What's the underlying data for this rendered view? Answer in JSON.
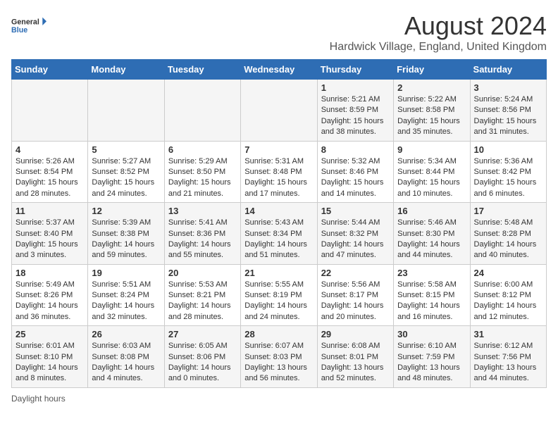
{
  "header": {
    "logo_general": "General",
    "logo_blue": "Blue",
    "main_title": "August 2024",
    "subtitle": "Hardwick Village, England, United Kingdom"
  },
  "days_of_week": [
    "Sunday",
    "Monday",
    "Tuesday",
    "Wednesday",
    "Thursday",
    "Friday",
    "Saturday"
  ],
  "weeks": [
    [
      {
        "day": "",
        "info": ""
      },
      {
        "day": "",
        "info": ""
      },
      {
        "day": "",
        "info": ""
      },
      {
        "day": "",
        "info": ""
      },
      {
        "day": "1",
        "info": "Sunrise: 5:21 AM\nSunset: 8:59 PM\nDaylight: 15 hours\nand 38 minutes."
      },
      {
        "day": "2",
        "info": "Sunrise: 5:22 AM\nSunset: 8:58 PM\nDaylight: 15 hours\nand 35 minutes."
      },
      {
        "day": "3",
        "info": "Sunrise: 5:24 AM\nSunset: 8:56 PM\nDaylight: 15 hours\nand 31 minutes."
      }
    ],
    [
      {
        "day": "4",
        "info": "Sunrise: 5:26 AM\nSunset: 8:54 PM\nDaylight: 15 hours\nand 28 minutes."
      },
      {
        "day": "5",
        "info": "Sunrise: 5:27 AM\nSunset: 8:52 PM\nDaylight: 15 hours\nand 24 minutes."
      },
      {
        "day": "6",
        "info": "Sunrise: 5:29 AM\nSunset: 8:50 PM\nDaylight: 15 hours\nand 21 minutes."
      },
      {
        "day": "7",
        "info": "Sunrise: 5:31 AM\nSunset: 8:48 PM\nDaylight: 15 hours\nand 17 minutes."
      },
      {
        "day": "8",
        "info": "Sunrise: 5:32 AM\nSunset: 8:46 PM\nDaylight: 15 hours\nand 14 minutes."
      },
      {
        "day": "9",
        "info": "Sunrise: 5:34 AM\nSunset: 8:44 PM\nDaylight: 15 hours\nand 10 minutes."
      },
      {
        "day": "10",
        "info": "Sunrise: 5:36 AM\nSunset: 8:42 PM\nDaylight: 15 hours\nand 6 minutes."
      }
    ],
    [
      {
        "day": "11",
        "info": "Sunrise: 5:37 AM\nSunset: 8:40 PM\nDaylight: 15 hours\nand 3 minutes."
      },
      {
        "day": "12",
        "info": "Sunrise: 5:39 AM\nSunset: 8:38 PM\nDaylight: 14 hours\nand 59 minutes."
      },
      {
        "day": "13",
        "info": "Sunrise: 5:41 AM\nSunset: 8:36 PM\nDaylight: 14 hours\nand 55 minutes."
      },
      {
        "day": "14",
        "info": "Sunrise: 5:43 AM\nSunset: 8:34 PM\nDaylight: 14 hours\nand 51 minutes."
      },
      {
        "day": "15",
        "info": "Sunrise: 5:44 AM\nSunset: 8:32 PM\nDaylight: 14 hours\nand 47 minutes."
      },
      {
        "day": "16",
        "info": "Sunrise: 5:46 AM\nSunset: 8:30 PM\nDaylight: 14 hours\nand 44 minutes."
      },
      {
        "day": "17",
        "info": "Sunrise: 5:48 AM\nSunset: 8:28 PM\nDaylight: 14 hours\nand 40 minutes."
      }
    ],
    [
      {
        "day": "18",
        "info": "Sunrise: 5:49 AM\nSunset: 8:26 PM\nDaylight: 14 hours\nand 36 minutes."
      },
      {
        "day": "19",
        "info": "Sunrise: 5:51 AM\nSunset: 8:24 PM\nDaylight: 14 hours\nand 32 minutes."
      },
      {
        "day": "20",
        "info": "Sunrise: 5:53 AM\nSunset: 8:21 PM\nDaylight: 14 hours\nand 28 minutes."
      },
      {
        "day": "21",
        "info": "Sunrise: 5:55 AM\nSunset: 8:19 PM\nDaylight: 14 hours\nand 24 minutes."
      },
      {
        "day": "22",
        "info": "Sunrise: 5:56 AM\nSunset: 8:17 PM\nDaylight: 14 hours\nand 20 minutes."
      },
      {
        "day": "23",
        "info": "Sunrise: 5:58 AM\nSunset: 8:15 PM\nDaylight: 14 hours\nand 16 minutes."
      },
      {
        "day": "24",
        "info": "Sunrise: 6:00 AM\nSunset: 8:12 PM\nDaylight: 14 hours\nand 12 minutes."
      }
    ],
    [
      {
        "day": "25",
        "info": "Sunrise: 6:01 AM\nSunset: 8:10 PM\nDaylight: 14 hours\nand 8 minutes."
      },
      {
        "day": "26",
        "info": "Sunrise: 6:03 AM\nSunset: 8:08 PM\nDaylight: 14 hours\nand 4 minutes."
      },
      {
        "day": "27",
        "info": "Sunrise: 6:05 AM\nSunset: 8:06 PM\nDaylight: 14 hours\nand 0 minutes."
      },
      {
        "day": "28",
        "info": "Sunrise: 6:07 AM\nSunset: 8:03 PM\nDaylight: 13 hours\nand 56 minutes."
      },
      {
        "day": "29",
        "info": "Sunrise: 6:08 AM\nSunset: 8:01 PM\nDaylight: 13 hours\nand 52 minutes."
      },
      {
        "day": "30",
        "info": "Sunrise: 6:10 AM\nSunset: 7:59 PM\nDaylight: 13 hours\nand 48 minutes."
      },
      {
        "day": "31",
        "info": "Sunrise: 6:12 AM\nSunset: 7:56 PM\nDaylight: 13 hours\nand 44 minutes."
      }
    ]
  ],
  "footer": {
    "daylight_hours": "Daylight hours"
  }
}
